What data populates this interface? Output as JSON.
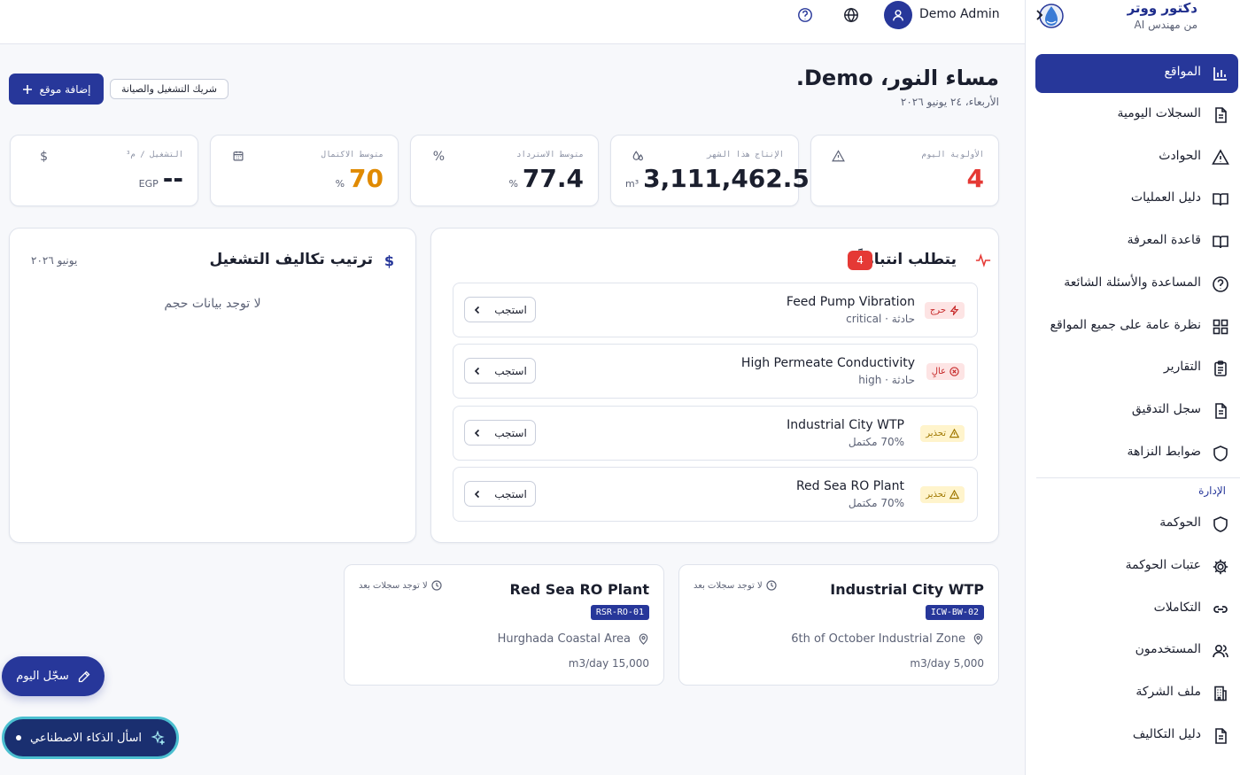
{
  "brand": {
    "title": "دكتور ووتر",
    "subtitle": "من مهندس AI"
  },
  "header": {
    "user_name": "Demo Admin"
  },
  "sidebar": {
    "items": [
      {
        "label": "المواقع",
        "icon": "bar-chart-icon",
        "active": true
      },
      {
        "label": "السجلات اليومية",
        "icon": "document-icon"
      },
      {
        "label": "الحوادث",
        "icon": "warning-icon"
      },
      {
        "label": "دليل العمليات",
        "icon": "book-icon"
      },
      {
        "label": "قاعدة المعرفة",
        "icon": "book-icon"
      },
      {
        "label": "المساعدة والأسئلة الشائعة",
        "icon": "help-icon"
      },
      {
        "label": "نظرة عامة على جميع المواقع",
        "icon": "grid-icon"
      },
      {
        "label": "التقارير",
        "icon": "clipboard-icon"
      },
      {
        "label": "سجل التدقيق",
        "icon": "document-icon"
      },
      {
        "label": "ضوابط النزاهة",
        "icon": "shield-icon"
      }
    ],
    "section_label": "الإدارة",
    "admin_items": [
      {
        "label": "الحوكمة",
        "icon": "shield-icon"
      },
      {
        "label": "عتبات الحوكمة",
        "icon": "gear-icon"
      },
      {
        "label": "التكاملات",
        "icon": "link-icon"
      },
      {
        "label": "المستخدمون",
        "icon": "users-icon"
      },
      {
        "label": "ملف الشركة",
        "icon": "building-icon"
      },
      {
        "label": "دليل التكاليف",
        "icon": "document-icon"
      }
    ]
  },
  "greeting": {
    "title": "مساء النور، Demo.",
    "date": "الأربعاء، ٢٤ يونيو ٢٠٢٦"
  },
  "actions": {
    "add_site": "إضافة موقع",
    "partner": "شريك التشغيل والصيانة"
  },
  "stats": [
    {
      "label": "الأولوية اليوم",
      "value": "4",
      "unit": "",
      "icon": "warning-icon",
      "color": "#e53935"
    },
    {
      "label": "الإنتاج هذا الشهر",
      "value": "3,111,462.5",
      "unit": "m³",
      "icon": "droplets-icon",
      "color": "#1b1f2e"
    },
    {
      "label": "متوسط الاسترداد",
      "value": "77.4",
      "unit": "%",
      "icon": "percent-icon",
      "icon_glyph": "%",
      "color": "#1b1f2e"
    },
    {
      "label": "متوسط الاكتمال",
      "value": "70",
      "unit": "%",
      "icon": "calendar-icon",
      "color": "#e08a00"
    },
    {
      "label": "التشغيل / م³",
      "value": "--",
      "unit": "EGP",
      "icon": "dollar-icon",
      "icon_glyph": "$",
      "color": "#1b1f2e"
    }
  ],
  "attention": {
    "title": "يتطلب انتباهاً",
    "count": "4",
    "items": [
      {
        "title": "Feed Pump Vibration",
        "subtitle": "حادثة · critical",
        "severity": "حرج",
        "level": "crit",
        "action": "استجب"
      },
      {
        "title": "High Permeate Conductivity",
        "subtitle": "حادثة · high",
        "severity": "عالٍ",
        "level": "high",
        "action": "استجب"
      },
      {
        "title": "Industrial City WTP",
        "subtitle": "70% مكتمل",
        "severity": "تحذير",
        "level": "warn",
        "action": "استجب"
      },
      {
        "title": "Red Sea RO Plant",
        "subtitle": "70% مكتمل",
        "severity": "تحذير",
        "level": "warn",
        "action": "استجب"
      }
    ]
  },
  "costs": {
    "title": "ترتيب تكاليف التشغيل",
    "period": "يونيو ٢٠٢٦",
    "empty": "لا توجد بيانات حجم"
  },
  "sites": [
    {
      "name": "Industrial City WTP",
      "code": "ICW-BW-02",
      "location": "6th of October Industrial Zone",
      "capacity": "m3/day 5,000",
      "status": "لا توجد سجلات بعد"
    },
    {
      "name": "Red Sea RO Plant",
      "code": "RSR-RO-01",
      "location": "Hurghada Coastal Area",
      "capacity": "m3/day 15,000",
      "status": "لا توجد سجلات بعد"
    }
  ],
  "fab": {
    "log_today": "سجّل اليوم",
    "ask_ai": "اسأل الذكاء الاصطناعي"
  }
}
